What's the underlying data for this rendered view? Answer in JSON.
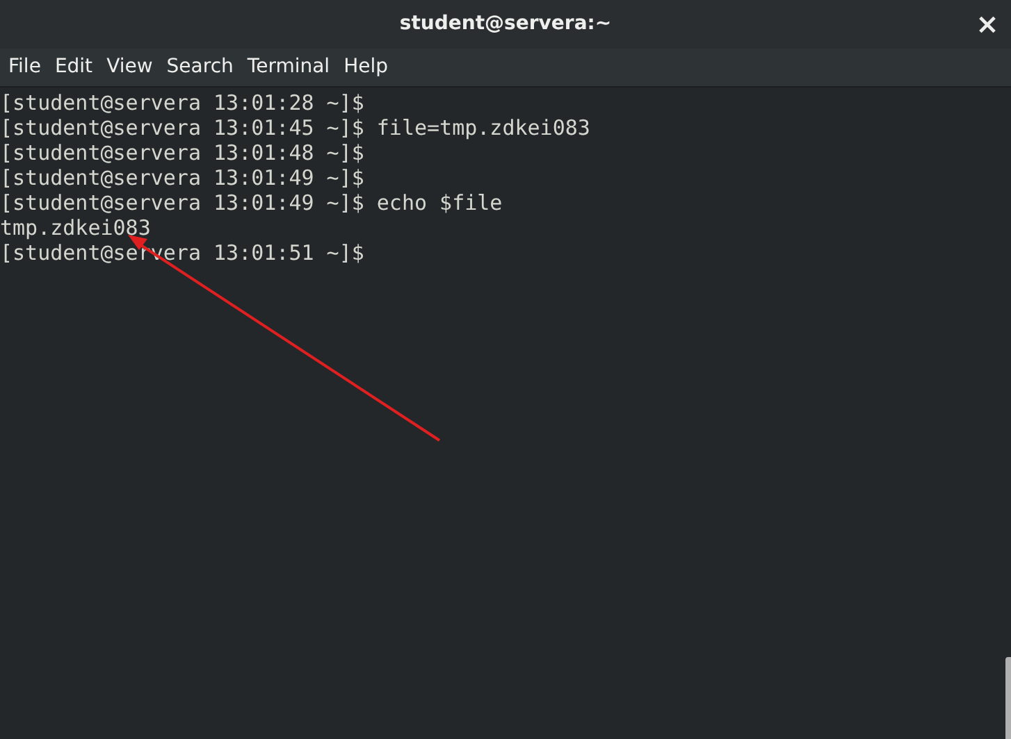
{
  "window": {
    "title": "student@servera:~",
    "close": "×"
  },
  "menu": [
    "File",
    "Edit",
    "View",
    "Search",
    "Terminal",
    "Help"
  ],
  "terminal": {
    "lines": [
      {
        "prompt": "[student@servera 13:01:28 ~]$"
      },
      {
        "prompt": "[student@servera 13:01:45 ~]$",
        "command": "file=tmp.zdkei083"
      },
      {
        "prompt": "[student@servera 13:01:48 ~]$"
      },
      {
        "prompt": "[student@servera 13:01:49 ~]$"
      },
      {
        "prompt": "[student@servera 13:01:49 ~]$",
        "command": "echo $file"
      },
      {
        "command": "tmp.zdkei083"
      },
      {
        "prompt": "[student@servera 13:01:51 ~]$"
      }
    ]
  }
}
